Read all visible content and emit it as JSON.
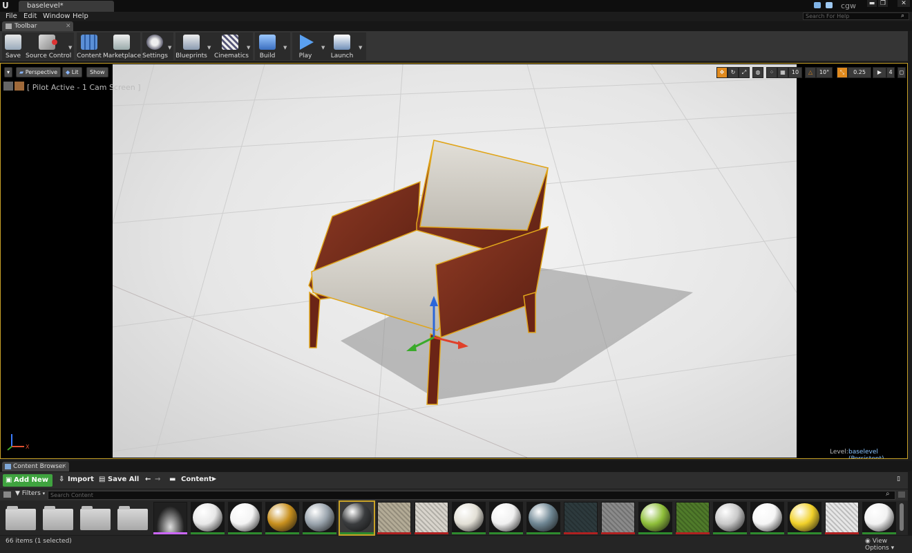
{
  "titlebar": {
    "logo": "U",
    "doc_tab": "baselevel*",
    "user": "cgw",
    "minimize": "▬",
    "restore": "❐",
    "close": "✕"
  },
  "menu": {
    "items": [
      "File",
      "Edit",
      "Window",
      "Help"
    ],
    "search_placeholder": "Search For Help"
  },
  "toolbar": {
    "tab_label": "Toolbar",
    "buttons": [
      {
        "label": "Save",
        "icon": "save-icon"
      },
      {
        "label": "Source Control",
        "icon": "source-control-icon"
      },
      {
        "label": "Content",
        "icon": "content-icon"
      },
      {
        "label": "Marketplace",
        "icon": "marketplace-icon"
      },
      {
        "label": "Settings",
        "icon": "settings-icon"
      },
      {
        "label": "Blueprints",
        "icon": "blueprints-icon"
      },
      {
        "label": "Cinematics",
        "icon": "cinematics-icon"
      },
      {
        "label": "Build",
        "icon": "build-icon"
      },
      {
        "label": "Play",
        "icon": "play-icon"
      },
      {
        "label": "Launch",
        "icon": "launch-icon"
      }
    ]
  },
  "viewport": {
    "perspective_label": "Perspective",
    "lit_label": "Lit",
    "show_label": "Show",
    "pilot_text": "[ Pilot Active - 1 Cam Screen ]",
    "grid_snap": "10",
    "rotation_snap": "10°",
    "scale_snap": "0.25",
    "camera_speed": "4",
    "level_label": "Level:",
    "level_name": "baselevel (Persistent)",
    "axis_x": "X"
  },
  "content_browser": {
    "tab_label": "Content Browser",
    "add_new_label": "Add New",
    "import_label": "Import",
    "save_all_label": "Save All",
    "path_label": "Content",
    "filters_label": "Filters",
    "search_placeholder": "Search Content",
    "item_count": "66 items (1 selected)",
    "view_options_label": "View Options",
    "selected_index": 9,
    "assets": [
      {
        "kind": "folder"
      },
      {
        "kind": "folder"
      },
      {
        "kind": "folder"
      },
      {
        "kind": "folder"
      },
      {
        "kind": "texture",
        "color": "#202020",
        "under": "#cc66ff"
      },
      {
        "kind": "sphere",
        "color": "#e8e8e8",
        "under": "#2e8b2e"
      },
      {
        "kind": "sphere",
        "color": "#f4f4f4",
        "under": "#2e8b2e"
      },
      {
        "kind": "sphere",
        "color": "#c8901e",
        "under": "#2e8b2e"
      },
      {
        "kind": "sphere",
        "color": "#9aa4ad",
        "under": "#2e8b2e"
      },
      {
        "kind": "sphere",
        "color": "#3a3c3e",
        "under": "#2e8b2e"
      },
      {
        "kind": "swatch",
        "color": "#b3ab96",
        "under": "#b02020"
      },
      {
        "kind": "swatch",
        "color": "#d8d4cc",
        "under": "#b02020"
      },
      {
        "kind": "sphere",
        "color": "#e3e0d6",
        "under": "#2e8b2e"
      },
      {
        "kind": "sphere",
        "color": "#f0f0f0",
        "under": "#2e8b2e"
      },
      {
        "kind": "sphere",
        "color": "#6f8794",
        "under": "#2e8b2e"
      },
      {
        "kind": "swatch",
        "color": "#2d3a3d",
        "under": "#b02020"
      },
      {
        "kind": "swatch",
        "color": "#8a8a8a",
        "under": "#b02020"
      },
      {
        "kind": "sphere",
        "color": "#8fbf3a",
        "under": "#2e8b2e"
      },
      {
        "kind": "swatch",
        "color": "#4f7a2a",
        "under": "#b02020"
      },
      {
        "kind": "sphere",
        "color": "#c9c9c9",
        "under": "#2e8b2e"
      },
      {
        "kind": "sphere",
        "color": "#f6f6f6",
        "under": "#2e8b2e"
      },
      {
        "kind": "sphere",
        "color": "#f1d12a",
        "under": "#2e8b2e"
      },
      {
        "kind": "swatch",
        "color": "#e6e6e6",
        "under": "#b02020"
      },
      {
        "kind": "sphere",
        "color": "#f2f2f2",
        "under": "#2e8b2e"
      }
    ]
  },
  "colors": {
    "selection": "#c9a227",
    "add_new": "#3fa33f",
    "level_link": "#88c4ff"
  }
}
